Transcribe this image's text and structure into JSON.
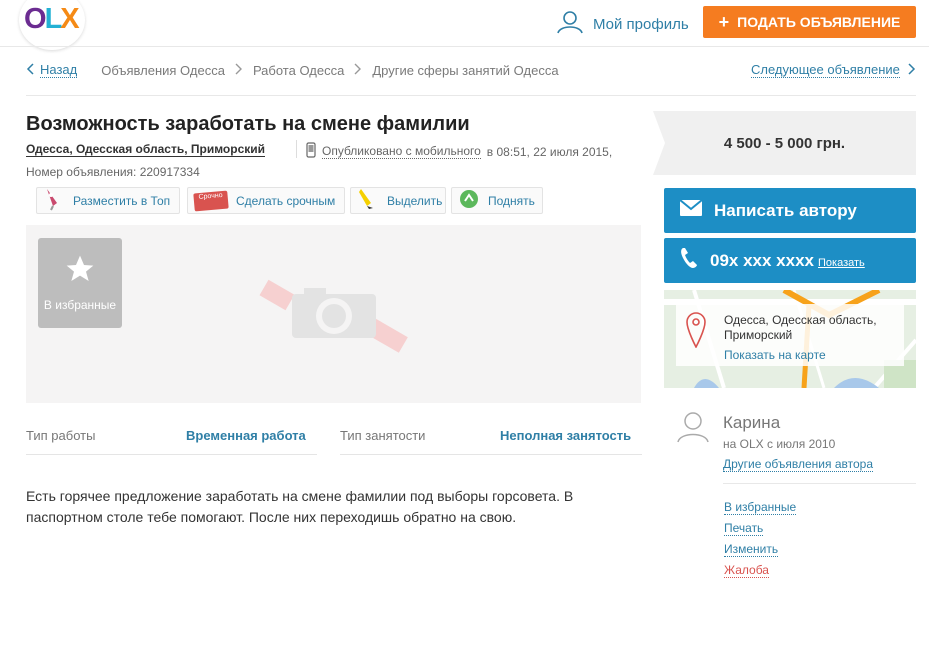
{
  "header": {
    "logo": {
      "o": "O",
      "l": "L",
      "x": "X"
    },
    "profile_label": "Мой профиль",
    "post_button": "ПОДАТЬ ОБЪЯВЛЕНИЕ",
    "post_plus": "+"
  },
  "breadcrumb": {
    "back": "Назад",
    "items": [
      "Объявления Одесса",
      "Работа Одесса",
      "Другие сферы занятий Одесса"
    ],
    "next": "Следующее объявление"
  },
  "ad": {
    "title": "Возможность заработать на смене фамилии",
    "location": "Одесса, Одесская область, Приморский",
    "published_link": "Опубликовано с мобильного",
    "published_rest": "в 08:51, 22 июля 2015,",
    "ad_number": "Номер объявления: 220917334",
    "promo": [
      "Разместить в Топ",
      "Сделать срочным",
      "Выделить",
      "Поднять"
    ],
    "urgent_tag": "Срочно",
    "favorite": "В избранные",
    "params": [
      {
        "key": "Тип работы",
        "value": "Временная работа"
      },
      {
        "key": "Тип занятости",
        "value": "Неполная занятость"
      }
    ],
    "description": "Есть горячее предложение заработать на смене фамилии под выборы горсовета. В паспортном столе тебе помогают. После них переходишь обратно на свою."
  },
  "sidebar": {
    "price": "4 500 - 5 000 грн.",
    "write_author": "Написать автору",
    "phone": "09x xxx xxxx",
    "show": "Показать",
    "map": {
      "address": "Одесса, Одесская область, Приморский",
      "show_on_map": "Показать на карте"
    },
    "user": {
      "name": "Карина",
      "since": "на OLX с июля 2010",
      "other_ads": "Другие объявления автора"
    },
    "links": [
      "В избранные",
      "Печать",
      "Изменить",
      "Жалоба"
    ]
  },
  "colors": {
    "accent_orange": "#f57c20",
    "button_blue": "#1d8ec5",
    "link_blue": "#2f7fa6",
    "complaint_red": "#d9534f"
  }
}
